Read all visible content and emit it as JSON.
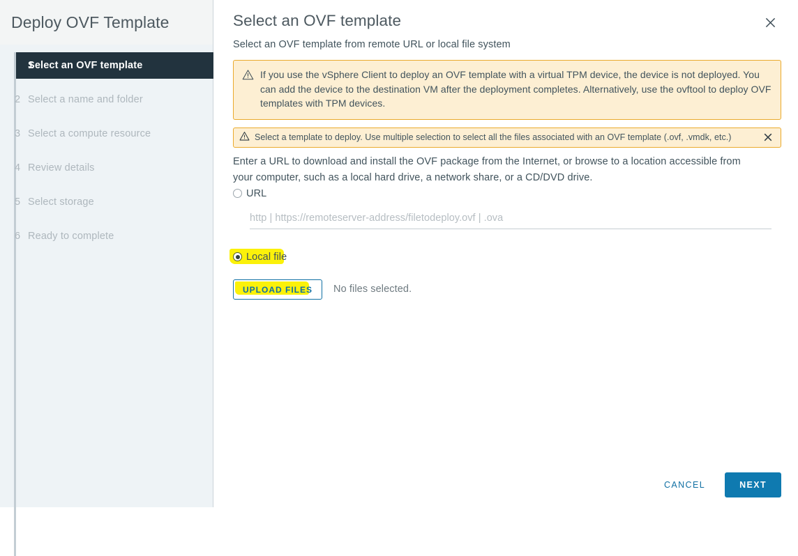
{
  "sidebar": {
    "title": "Deploy OVF Template",
    "steps": [
      {
        "num": "1",
        "label": "Select an OVF template",
        "state": "active"
      },
      {
        "num": "2",
        "label": "Select a name and folder",
        "state": "pending"
      },
      {
        "num": "3",
        "label": "Select a compute resource",
        "state": "pending"
      },
      {
        "num": "4",
        "label": "Review details",
        "state": "pending"
      },
      {
        "num": "5",
        "label": "Select storage",
        "state": "pending"
      },
      {
        "num": "6",
        "label": "Ready to complete",
        "state": "pending"
      }
    ]
  },
  "main": {
    "title": "Select an OVF template",
    "subtitle": "Select an OVF template from remote URL or local file system",
    "close_icon": "close-icon",
    "alerts": [
      {
        "icon": "warning-triangle-icon",
        "text": "If you use the vSphere Client to deploy an OVF template with a virtual TPM device, the device is not deployed. You can add the device to the destination VM after the deployment completes. Alternatively, use the ovftool to deploy OVF templates with TPM devices.",
        "dismissible": false
      },
      {
        "icon": "warning-triangle-icon",
        "text": "Select a template to deploy. Use multiple selection to select all the files associated with an OVF template (.ovf, .vmdk, etc.)",
        "dismissible": true,
        "close_icon": "close-icon"
      }
    ],
    "instructions": "Enter a URL to download and install the OVF package from the Internet, or browse to a location accessible from your computer, such as a local hard drive, a network share, or a CD/DVD drive.",
    "source_options": [
      {
        "label": "URL",
        "selected": false,
        "highlighted": false
      },
      {
        "label": "Local file",
        "selected": true,
        "highlighted": true
      }
    ],
    "url_input": {
      "value": "",
      "placeholder": "http | https://remoteserver-address/filetodeploy.ovf | .ova"
    },
    "upload": {
      "button_label": "UPLOAD FILES",
      "status": "No files selected.",
      "highlighted": true
    }
  },
  "footer": {
    "cancel_label": "CANCEL",
    "next_label": "NEXT"
  },
  "colors": {
    "accent": "#0f7ab0",
    "link": "#0f6fa3",
    "active_step_bg": "#22333e",
    "sidebar_bg": "#eef3f6",
    "alert_bg": "#fdefd3",
    "alert_border": "#eaaa2c",
    "highlight": "#fbf10a"
  }
}
